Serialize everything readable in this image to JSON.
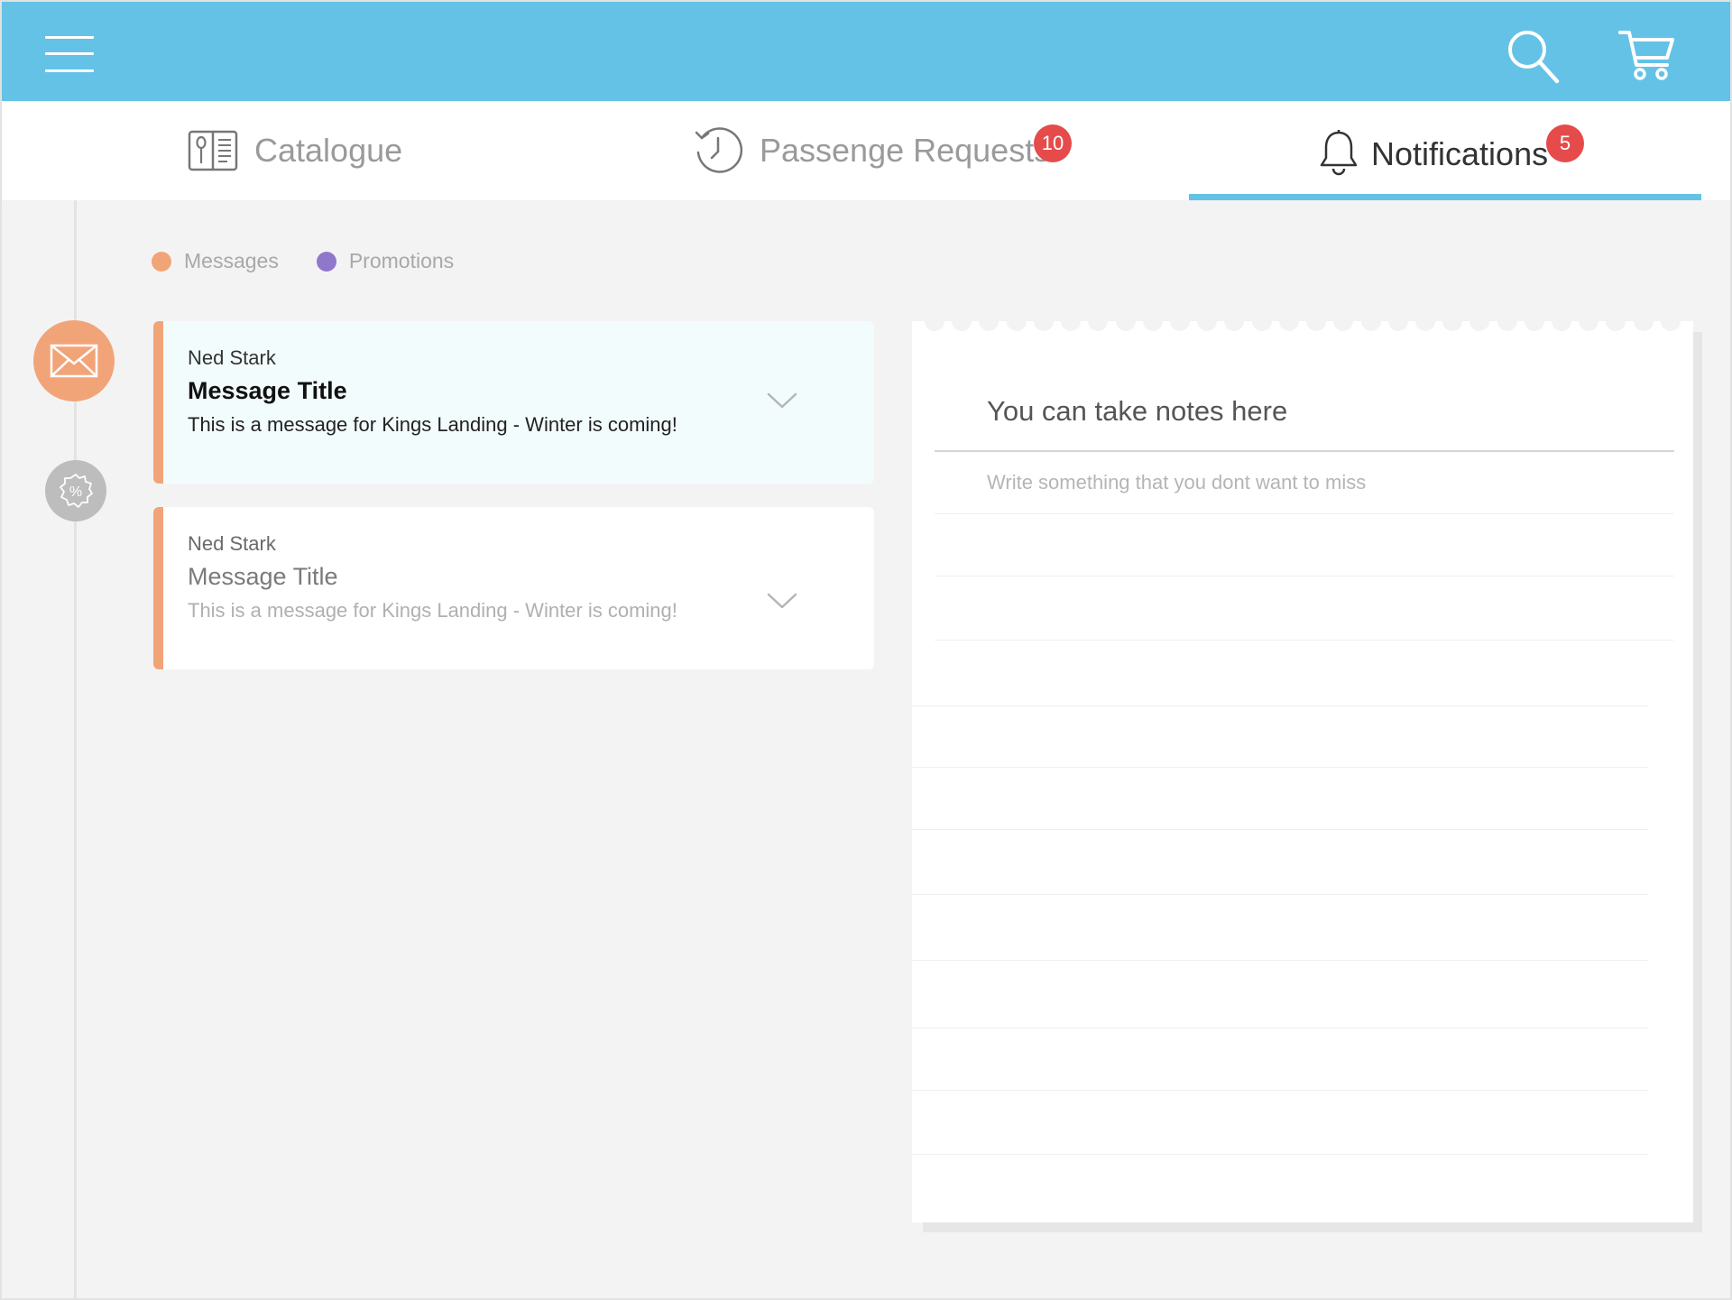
{
  "header": {
    "menu_icon": "hamburger-menu-icon",
    "search_icon": "search-icon",
    "cart_icon": "shopping-cart-icon",
    "background_color": "#64c2e6"
  },
  "tabs": [
    {
      "label": "Catalogue",
      "icon": "menu-book-icon",
      "active": false
    },
    {
      "label": "Passenge Requests",
      "icon": "history-clock-icon",
      "badge": "10",
      "active": false
    },
    {
      "label": "Notifications",
      "icon": "bell-icon",
      "badge": "5",
      "active": true
    }
  ],
  "legend": [
    {
      "label": "Messages",
      "color": "#f2a479"
    },
    {
      "label": "Promotions",
      "color": "#8f78cc"
    }
  ],
  "timeline": {
    "messages_icon": "envelope-icon",
    "promotions_icon": "discount-badge-icon"
  },
  "messages": [
    {
      "sender": "Ned Stark",
      "title": "Message Title",
      "body": "This is a message for Kings Landing - Winter is coming!",
      "unread": true
    },
    {
      "sender": "Ned Stark",
      "title": "Message Title",
      "body": "This is a message for Kings Landing - Winter is coming!",
      "unread": false
    }
  ],
  "notes": {
    "heading": "You can take notes here",
    "placeholder": "Write something that you dont want to miss",
    "value": ""
  }
}
